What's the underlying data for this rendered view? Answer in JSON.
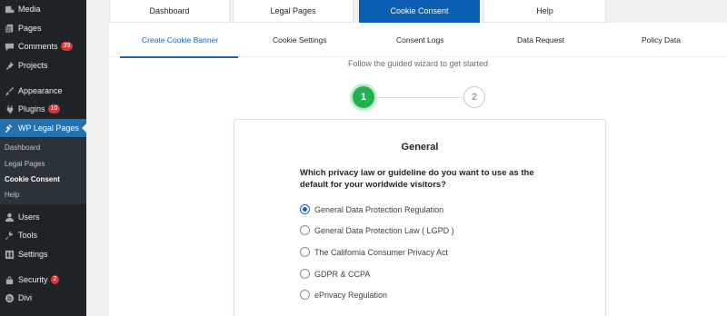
{
  "sidebar": {
    "items": [
      {
        "label": "Media",
        "icon": "media-icon"
      },
      {
        "label": "Pages",
        "icon": "pages-icon"
      },
      {
        "label": "Comments",
        "icon": "comments-icon",
        "badge": "39"
      },
      {
        "label": "Projects",
        "icon": "projects-icon"
      },
      {
        "label": "Appearance",
        "icon": "appearance-icon"
      },
      {
        "label": "Plugins",
        "icon": "plugins-icon",
        "badge": "10"
      },
      {
        "label": "WP Legal Pages",
        "icon": "gavel-icon"
      },
      {
        "label": "Users",
        "icon": "users-icon"
      },
      {
        "label": "Tools",
        "icon": "tools-icon"
      },
      {
        "label": "Settings",
        "icon": "settings-icon"
      },
      {
        "label": "Security",
        "icon": "lock-icon",
        "badge": "2"
      },
      {
        "label": "Divi",
        "icon": "divi-icon"
      }
    ],
    "submenu": [
      "Dashboard",
      "Legal Pages",
      "Cookie Consent",
      "Help"
    ]
  },
  "main_tabs": [
    "Dashboard",
    "Legal Pages",
    "Cookie Consent",
    "Help"
  ],
  "sub_tabs": [
    "Create Cookie Banner",
    "Cookie Settings",
    "Consent Logs",
    "Data Request",
    "Policy Data"
  ],
  "wizard": {
    "hint": "Follow the guided wizard to get started",
    "step1": "1",
    "step2": "2"
  },
  "card": {
    "title": "General",
    "question": "Which privacy law or guideline do you want to use as the default for your worldwide visitors?",
    "options": [
      "General Data Protection Regulation",
      "General Data Protection Law ( LGPD )",
      "The California Consumer Privacy Act",
      "GDPR & CCPA",
      "ePrivacy Regulation"
    ],
    "selected_index": 0
  },
  "colors": {
    "sidebar_bg": "#1d2327",
    "active_blue": "#2271b1",
    "tab_active": "#0b5fb3",
    "step_green": "#22b14c"
  }
}
